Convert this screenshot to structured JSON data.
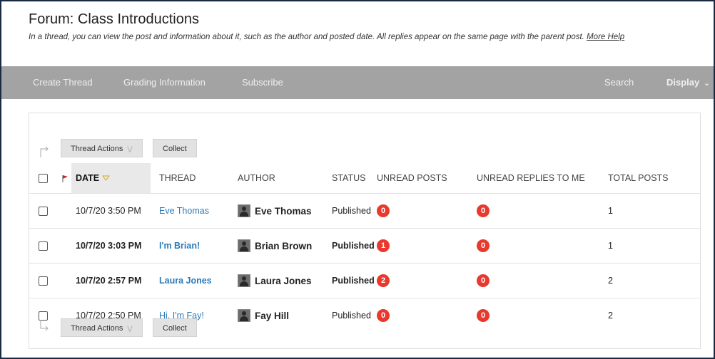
{
  "header": {
    "title": "Forum: Class Introductions",
    "subtitle": "In a thread, you can view the post and information about it, such as the author and posted date. All replies appear on the same page with the parent post.",
    "help_link": "More Help"
  },
  "toolbar": {
    "create_thread": "Create Thread",
    "grading_information": "Grading Information",
    "subscribe": "Subscribe",
    "search": "Search",
    "display": "Display"
  },
  "actions": {
    "thread_actions": "Thread Actions",
    "collect": "Collect"
  },
  "columns": {
    "date": "DATE",
    "thread": "THREAD",
    "author": "AUTHOR",
    "status": "STATUS",
    "unread_posts": "UNREAD POSTS",
    "unread_replies": "UNREAD REPLIES TO ME",
    "total_posts": "TOTAL POSTS"
  },
  "colors": {
    "badge_red": "#e8392f",
    "link_blue": "#2b7ab8",
    "toolbar_gray": "#a3a3a3"
  },
  "rows": [
    {
      "date": "10/7/20 3:50 PM",
      "thread": "Eve Thomas",
      "author": "Eve Thomas",
      "status": "Published",
      "unread_posts": "0",
      "unread_replies": "0",
      "total_posts": "1",
      "bold": false
    },
    {
      "date": "10/7/20 3:03 PM",
      "thread": "I'm Brian!",
      "author": "Brian Brown",
      "status": "Published",
      "unread_posts": "1",
      "unread_replies": "0",
      "total_posts": "1",
      "bold": true
    },
    {
      "date": "10/7/20 2:57 PM",
      "thread": "Laura Jones",
      "author": "Laura Jones",
      "status": "Published",
      "unread_posts": "2",
      "unread_replies": "0",
      "total_posts": "2",
      "bold": true
    },
    {
      "date": "10/7/20 2:50 PM",
      "thread": "Hi, I'm Fay!",
      "author": "Fay Hill",
      "status": "Published",
      "unread_posts": "0",
      "unread_replies": "0",
      "total_posts": "2",
      "bold": false
    }
  ]
}
